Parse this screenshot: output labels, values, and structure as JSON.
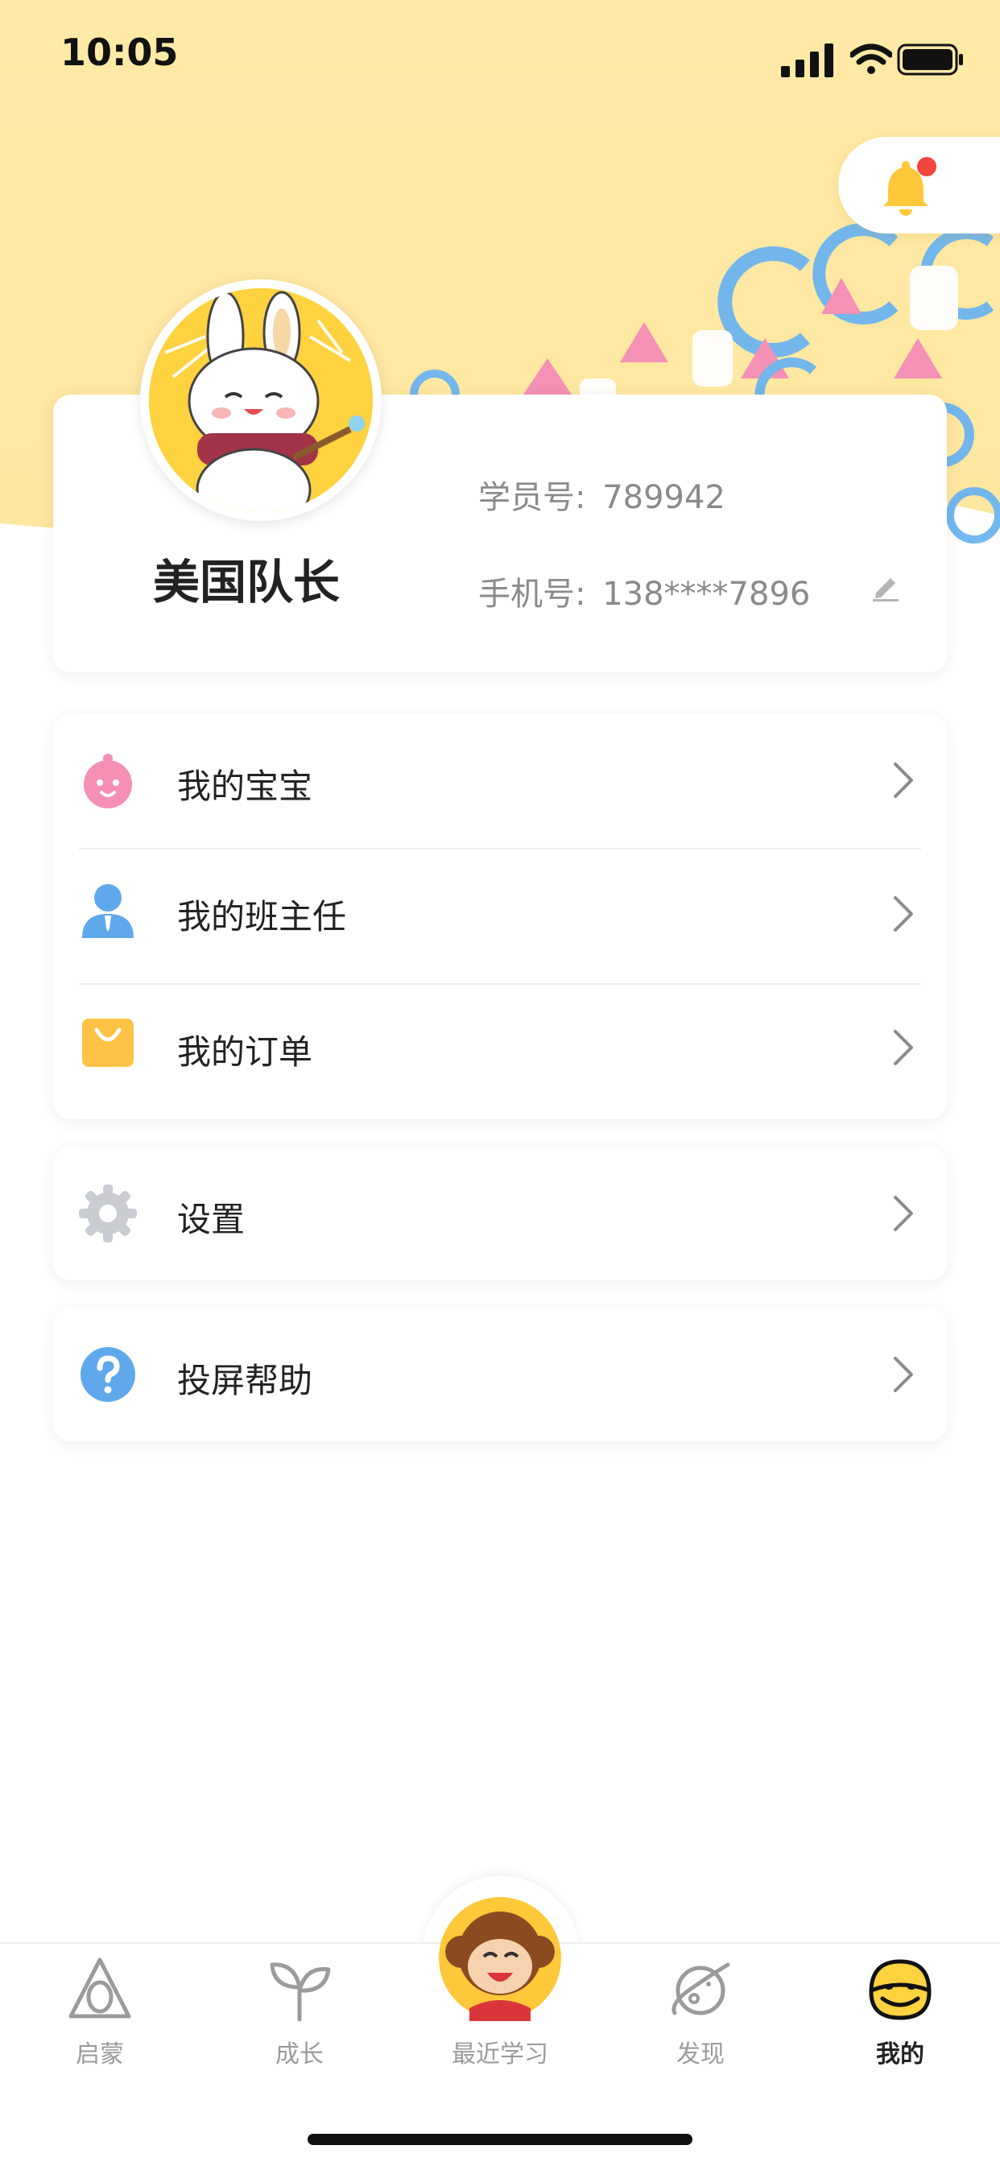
{
  "status_bar": {
    "time": "10:05"
  },
  "colors": {
    "header_yellow": "#FFE9A8",
    "accent_yellow": "#FFD23F",
    "pink": "#F58FB4",
    "blue": "#5FA8EC",
    "orange": "#FFC244",
    "notification_red": "#F2453D"
  },
  "header": {
    "bell_icon": "bell-icon",
    "has_notification": true
  },
  "profile": {
    "name": "美国队长",
    "student_label": "学员号:",
    "student_id": "789942",
    "phone_label": "手机号:",
    "phone": "138****7896",
    "edit_icon": "pencil-icon"
  },
  "menu_group1": [
    {
      "label": "我的宝宝",
      "icon": "baby-icon"
    },
    {
      "label": "我的班主任",
      "icon": "teacher-icon"
    },
    {
      "label": "我的订单",
      "icon": "shopping-bag-icon"
    }
  ],
  "menu_settings": {
    "label": "设置",
    "icon": "gear-icon"
  },
  "menu_help": {
    "label": "投屏帮助",
    "icon": "help-icon"
  },
  "tabbar": {
    "tabs": [
      {
        "label": "启蒙",
        "icon": "egg-icon",
        "active": false
      },
      {
        "label": "成长",
        "icon": "sprout-icon",
        "active": false
      },
      {
        "label": "最近学习",
        "icon": "monkey-icon",
        "active": false
      },
      {
        "label": "发现",
        "icon": "planet-icon",
        "active": false
      },
      {
        "label": "我的",
        "icon": "face-icon",
        "active": true
      }
    ]
  }
}
